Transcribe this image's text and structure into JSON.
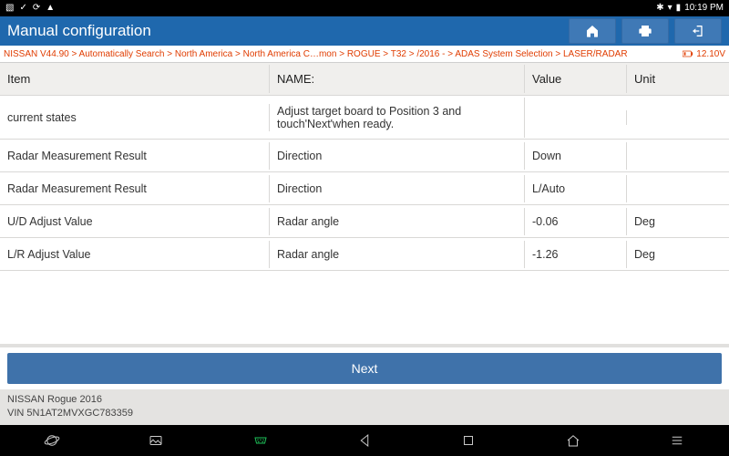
{
  "status": {
    "time": "10:19 PM"
  },
  "title": "Manual configuration",
  "breadcrumb": {
    "path": "NISSAN V44.90 > Automatically Search > North America > North America C…mon > ROGUE > T32 > /2016 - > ADAS System Selection > LASER/RADAR",
    "voltage": "12.10V"
  },
  "columns": {
    "item": "Item",
    "name": "NAME:",
    "value": "Value",
    "unit": "Unit"
  },
  "rows": [
    {
      "item": "current states",
      "name": "Adjust target board to Position 3 and touch'Next'when ready.",
      "value": "",
      "unit": "",
      "tall": true
    },
    {
      "item": "Radar Measurement Result",
      "name": "Direction",
      "value": "Down",
      "unit": ""
    },
    {
      "item": "Radar Measurement Result",
      "name": "Direction",
      "value": "L/Auto",
      "unit": ""
    },
    {
      "item": "U/D Adjust Value",
      "name": "Radar angle",
      "value": "-0.06",
      "unit": "Deg"
    },
    {
      "item": "L/R Adjust Value",
      "name": "Radar angle",
      "value": "-1.26",
      "unit": "Deg"
    }
  ],
  "next_label": "Next",
  "vehicle": {
    "line1": "NISSAN Rogue 2016",
    "line2": "VIN 5N1AT2MVXGC783359"
  }
}
